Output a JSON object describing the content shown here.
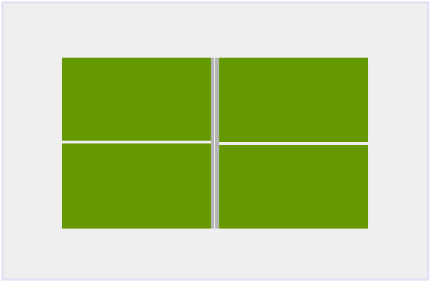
{
  "colors": {
    "background": "#efefef",
    "border": "#e0e0f6",
    "tile": "#669900",
    "divider": "#b5b5b5",
    "gap": "#ffffff"
  },
  "tiles": [
    {
      "id": "tile-top-left"
    },
    {
      "id": "tile-top-right"
    },
    {
      "id": "tile-bottom-left"
    },
    {
      "id": "tile-bottom-right"
    }
  ]
}
